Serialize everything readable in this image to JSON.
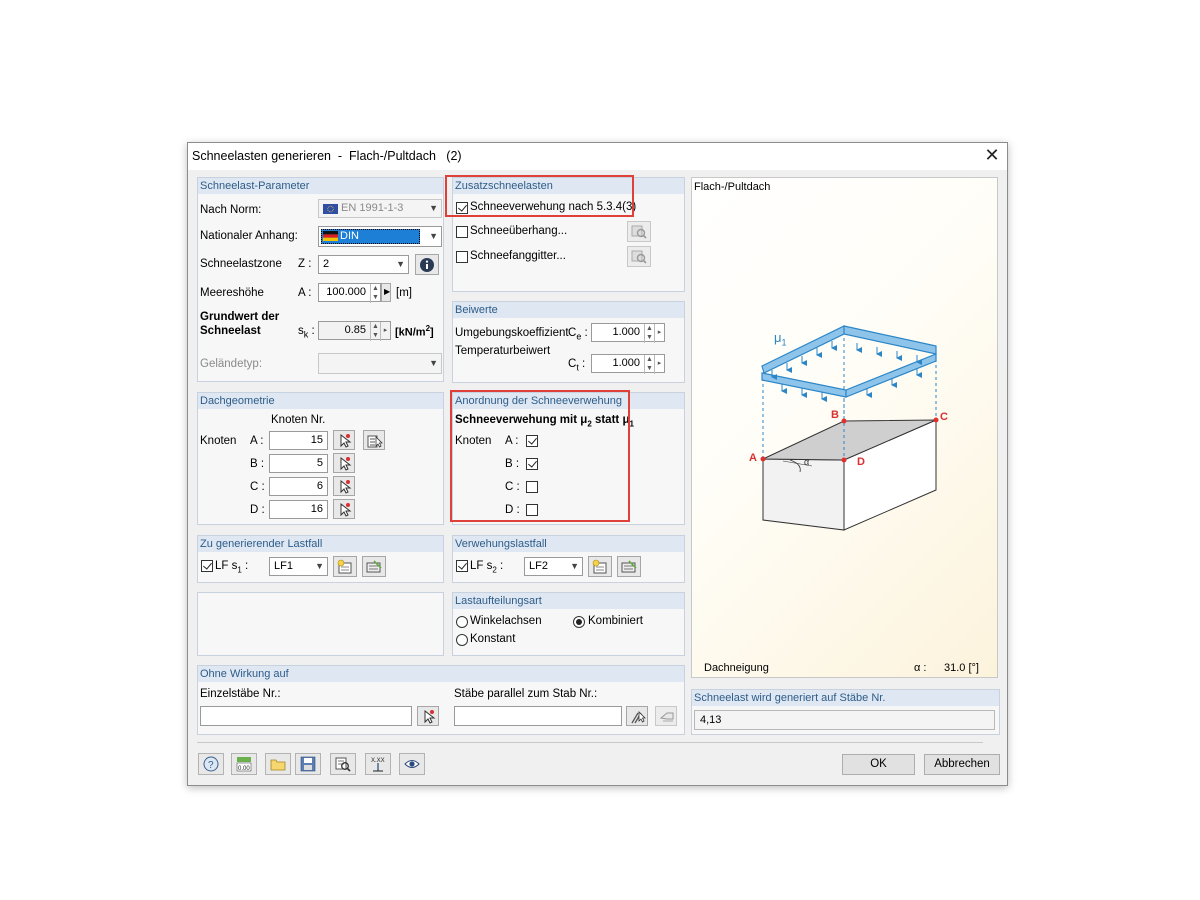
{
  "window": {
    "title": "Schneelasten generieren  -  Flach-/Pultdach   (2)",
    "close_glyph": "✕"
  },
  "params": {
    "header": "Schneelast-Parameter",
    "norm_label": "Nach Norm:",
    "norm_value": "EN 1991-1-3",
    "annex_label": "Nationaler Anhang:",
    "annex_value": "DIN",
    "zone_label": "Schneelastzone",
    "zone_symbol": "Z :",
    "zone_value": "2",
    "alt_label": "Meereshöhe",
    "alt_symbol": "A :",
    "alt_value": "100.000",
    "alt_unit": "[m]",
    "sk_label_1": "Grundwert der",
    "sk_label_2": "Schneelast",
    "sk_symbol": "s",
    "sk_sub": "k",
    "sk_colon": " :",
    "sk_value": "0.85",
    "sk_unit": "[kN/m",
    "sk_unit_sup": "2",
    "sk_unit_end": "]",
    "terrain_label": "Geländetyp:"
  },
  "additional": {
    "header": "Zusatzschneelasten",
    "drift_label": "Schneeverwehung nach 5.3.4(3)",
    "drift_checked": true,
    "overhang_label": "Schneeüberhang...",
    "overhang_checked": false,
    "guard_label": "Schneefanggitter...",
    "guard_checked": false
  },
  "coefficients": {
    "header": "Beiwerte",
    "ce_label": "Umgebungskoeffizient",
    "ce_symbol": "C",
    "ce_sub": "e",
    "ce_colon": " :",
    "ce_value": "1.000",
    "ct_label": "Temperaturbeiwert",
    "ct_symbol": "C",
    "ct_sub": "t",
    "ct_colon": " :",
    "ct_value": "1.000"
  },
  "geometry": {
    "header": "Dachgeometrie",
    "col_header": "Knoten Nr.",
    "row_label": "Knoten",
    "nodes": [
      {
        "label": "A :",
        "value": "15"
      },
      {
        "label": "B :",
        "value": "5"
      },
      {
        "label": "C :",
        "value": "6"
      },
      {
        "label": "D :",
        "value": "16"
      }
    ]
  },
  "drift": {
    "header": "Anordnung der Schneeverwehung",
    "title_pre": "Schneeverwehung mit ",
    "mu": "μ",
    "sub2": "2",
    "title_mid": " statt ",
    "sub1": "1",
    "row_label": "Knoten",
    "nodes": [
      {
        "label": "A :",
        "checked": true
      },
      {
        "label": "B :",
        "checked": true
      },
      {
        "label": "C :",
        "checked": false
      },
      {
        "label": "D :",
        "checked": false
      }
    ]
  },
  "loadcase": {
    "header": "Zu generierender Lastfall",
    "cb_label": "LF s",
    "cb_sub": "1",
    "cb_colon": " :",
    "checked": true,
    "value": "LF1"
  },
  "drift_loadcase": {
    "header": "Verwehungslastfall",
    "cb_label": "LF s",
    "cb_sub": "2",
    "cb_colon": " :",
    "checked": true,
    "value": "LF2"
  },
  "distribution": {
    "header": "Lastaufteilungsart",
    "opt1": "Winkelachsen",
    "opt2": "Kombiniert",
    "opt3": "Konstant",
    "selected": "Kombiniert"
  },
  "no_effect": {
    "header": "Ohne Wirkung auf",
    "members_label": "Einzelstäbe Nr.:",
    "members_value": "",
    "parallel_label": "Stäbe parallel zum Stab Nr.:",
    "parallel_value": ""
  },
  "preview": {
    "title": "Flach-/Pultdach",
    "mu_label": "μ",
    "mu_sub": "1",
    "corner_a": "A",
    "corner_b": "B",
    "corner_c": "C",
    "corner_d": "D",
    "alpha_small": "α",
    "slope_label": "Dachneigung",
    "slope_symbol": "α :",
    "slope_value": "31.0 [°]"
  },
  "generated": {
    "header": "Schneelast wird generiert auf Stäbe Nr.",
    "value": "4,13"
  },
  "buttons": {
    "ok": "OK",
    "cancel": "Abbrechen"
  },
  "toolbar": [
    "help-icon",
    "calculator-icon",
    "open-folder-icon",
    "save-icon",
    "view-details-icon",
    "coordinates-icon",
    "eye-icon"
  ],
  "colors": {
    "accent": "#2d5c8a",
    "highlight": "#e0403a",
    "load_arrow": "#2b86c8",
    "selection": "#1e7fd6"
  }
}
